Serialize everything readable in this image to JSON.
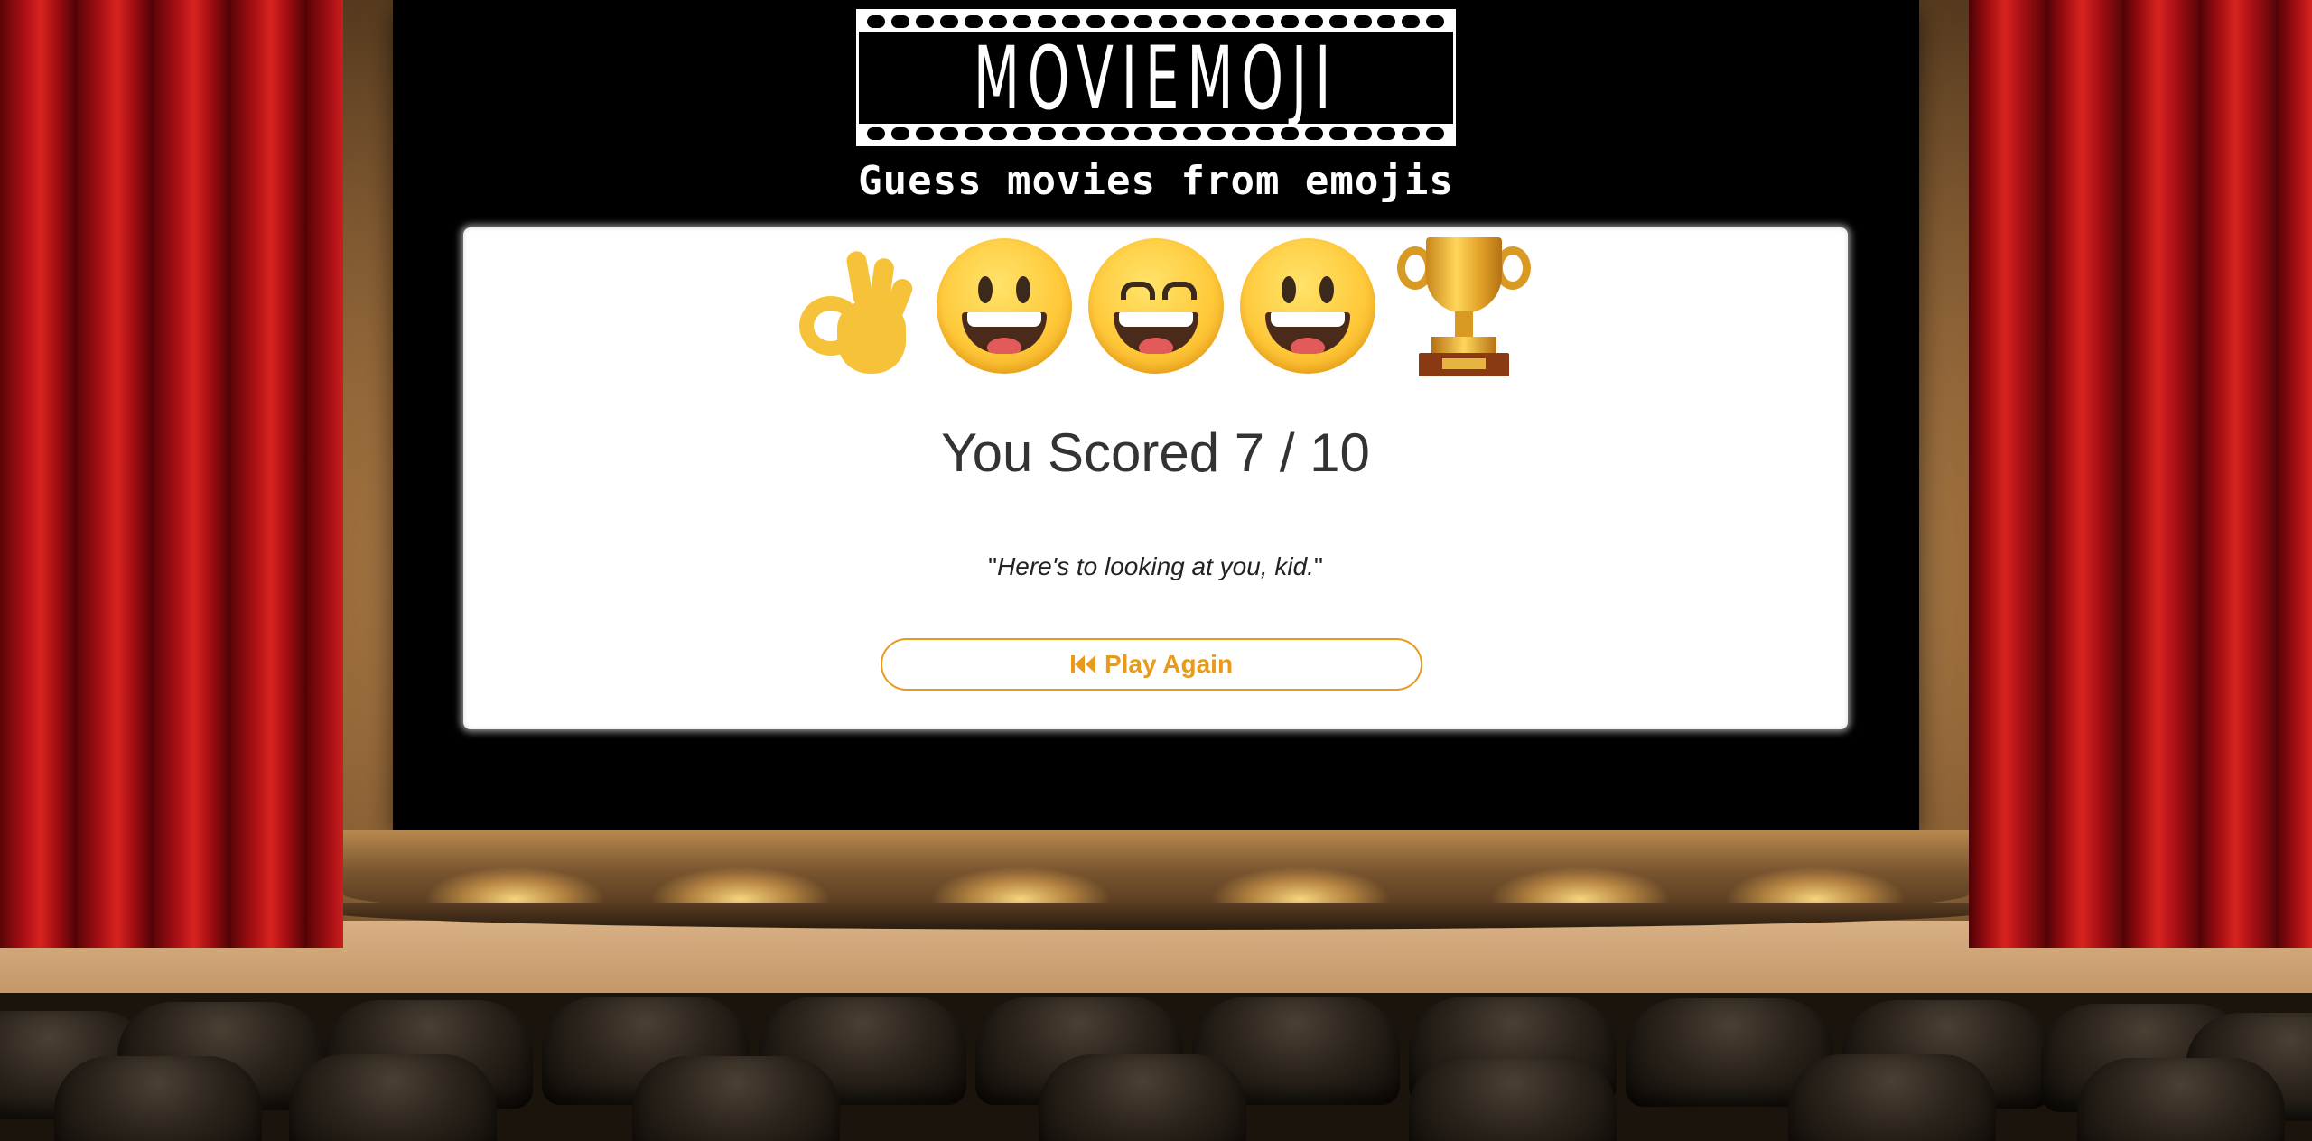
{
  "logo": {
    "text": "MOVIEMOJI"
  },
  "tagline": "Guess movies from emojis",
  "result": {
    "emojis": [
      "ok-hand-emoji",
      "grinning-face-emoji",
      "beaming-face-emoji",
      "grinning-face-emoji",
      "trophy-emoji"
    ],
    "score_text": "You Scored 7 / 10",
    "score": 7,
    "total": 10,
    "quote_open": "\"",
    "quote_body": "Here's to looking at you, kid.",
    "quote_close": "\""
  },
  "play_again": {
    "label": "Play Again",
    "icon": "rewind-icon",
    "color": "#e89a1a"
  }
}
